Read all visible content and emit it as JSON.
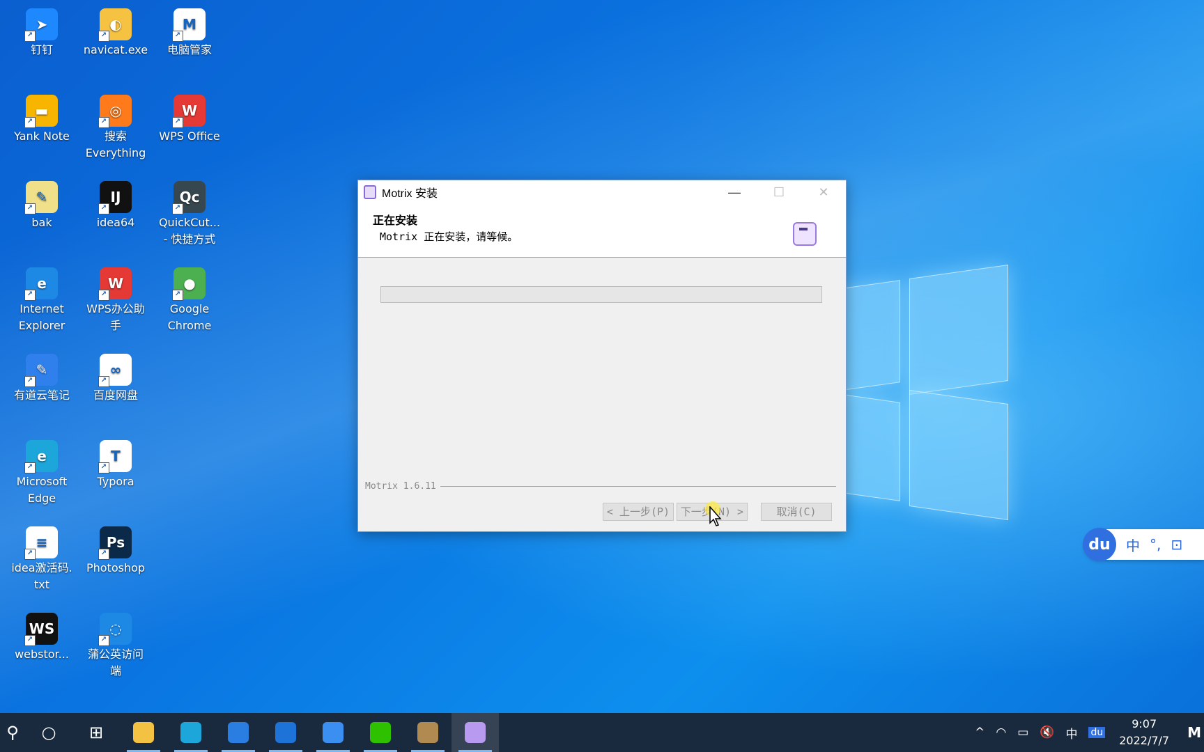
{
  "desktop": {
    "icons": [
      {
        "label": "钉钉",
        "glyph": "➤",
        "color": "#1e88ff",
        "col": 0,
        "row": 0
      },
      {
        "label": "navicat.exe",
        "glyph": "◐",
        "color": "#f5c242",
        "col": 1,
        "row": 0
      },
      {
        "label": "电脑管家",
        "glyph": "M",
        "color": "#ffffff",
        "col": 2,
        "row": 0
      },
      {
        "label": "Yank Note",
        "glyph": "▬",
        "color": "#f7b500",
        "col": 0,
        "row": 1
      },
      {
        "label": "搜索\nEverything",
        "glyph": "◎",
        "color": "#ff7a1a",
        "col": 1,
        "row": 1
      },
      {
        "label": "WPS Office",
        "glyph": "W",
        "color": "#e53935",
        "col": 2,
        "row": 1
      },
      {
        "label": "bak",
        "glyph": "✎",
        "color": "#f0e08a",
        "col": 0,
        "row": 2
      },
      {
        "label": "idea64",
        "glyph": "IJ",
        "color": "#111111",
        "col": 1,
        "row": 2
      },
      {
        "label": "QuickCut...\n- 快捷方式",
        "glyph": "Qc",
        "color": "#37474f",
        "col": 2,
        "row": 2
      },
      {
        "label": "Internet\nExplorer",
        "glyph": "e",
        "color": "#1e88e5",
        "col": 0,
        "row": 3
      },
      {
        "label": "WPS办公助\n手",
        "glyph": "W",
        "color": "#e53935",
        "col": 1,
        "row": 3
      },
      {
        "label": "Google\nChrome",
        "glyph": "●",
        "color": "#4caf50",
        "col": 2,
        "row": 3
      },
      {
        "label": "有道云笔记",
        "glyph": "✎",
        "color": "#2f80ed",
        "col": 0,
        "row": 4
      },
      {
        "label": "百度网盘",
        "glyph": "∞",
        "color": "#ffffff",
        "col": 1,
        "row": 4
      },
      {
        "label": "Microsoft\nEdge",
        "glyph": "e",
        "color": "#1ca6d9",
        "col": 0,
        "row": 5
      },
      {
        "label": "Typora",
        "glyph": "T",
        "color": "#ffffff",
        "col": 1,
        "row": 5
      },
      {
        "label": "idea激活码.\ntxt",
        "glyph": "≡",
        "color": "#ffffff",
        "col": 0,
        "row": 6
      },
      {
        "label": "Photoshop",
        "glyph": "Ps",
        "color": "#0b2a4a",
        "col": 1,
        "row": 6
      },
      {
        "label": "webstor...",
        "glyph": "WS",
        "color": "#111111",
        "col": 0,
        "row": 7
      },
      {
        "label": "蒲公英访问\n端",
        "glyph": "◌",
        "color": "#1e88e5",
        "col": 1,
        "row": 7
      }
    ]
  },
  "dialog": {
    "title": "Motrix 安装",
    "header_title": "正在安装",
    "header_subtitle": "Motrix 正在安装，请等候。",
    "progress": 0,
    "branding": "Motrix 1.6.11",
    "back_label": "< 上一步(P)",
    "next_label": "下一步(N) >",
    "cancel_label": "取消(C)",
    "controls": {
      "minimize": "—",
      "maximize": "☐",
      "close": "✕"
    }
  },
  "ime": {
    "logo": "du",
    "mode": "中",
    "punct": "°,",
    "tool": "⊡"
  },
  "taskbar": {
    "search_glyph": "⚲",
    "cortana_glyph": "○",
    "taskview_glyph": "⊞",
    "apps": [
      {
        "name": "file-explorer",
        "color": "#f4c242"
      },
      {
        "name": "edge",
        "color": "#1ca6d9"
      },
      {
        "name": "store",
        "color": "#2a7de1"
      },
      {
        "name": "mail",
        "color": "#1e73d8"
      },
      {
        "name": "youdao-note",
        "color": "#3a8ff0"
      },
      {
        "name": "wechat",
        "color": "#2dc100"
      },
      {
        "name": "photo-app",
        "color": "#b08a50"
      },
      {
        "name": "motrix",
        "color": "#b89af0"
      }
    ],
    "tray": {
      "chevron": "^",
      "network": "◠",
      "battery": "▭",
      "volume": "🔇",
      "ime_mode": "中",
      "baidu": "du",
      "time": "9:07",
      "date": "2022/7/7",
      "corner": "M"
    }
  }
}
